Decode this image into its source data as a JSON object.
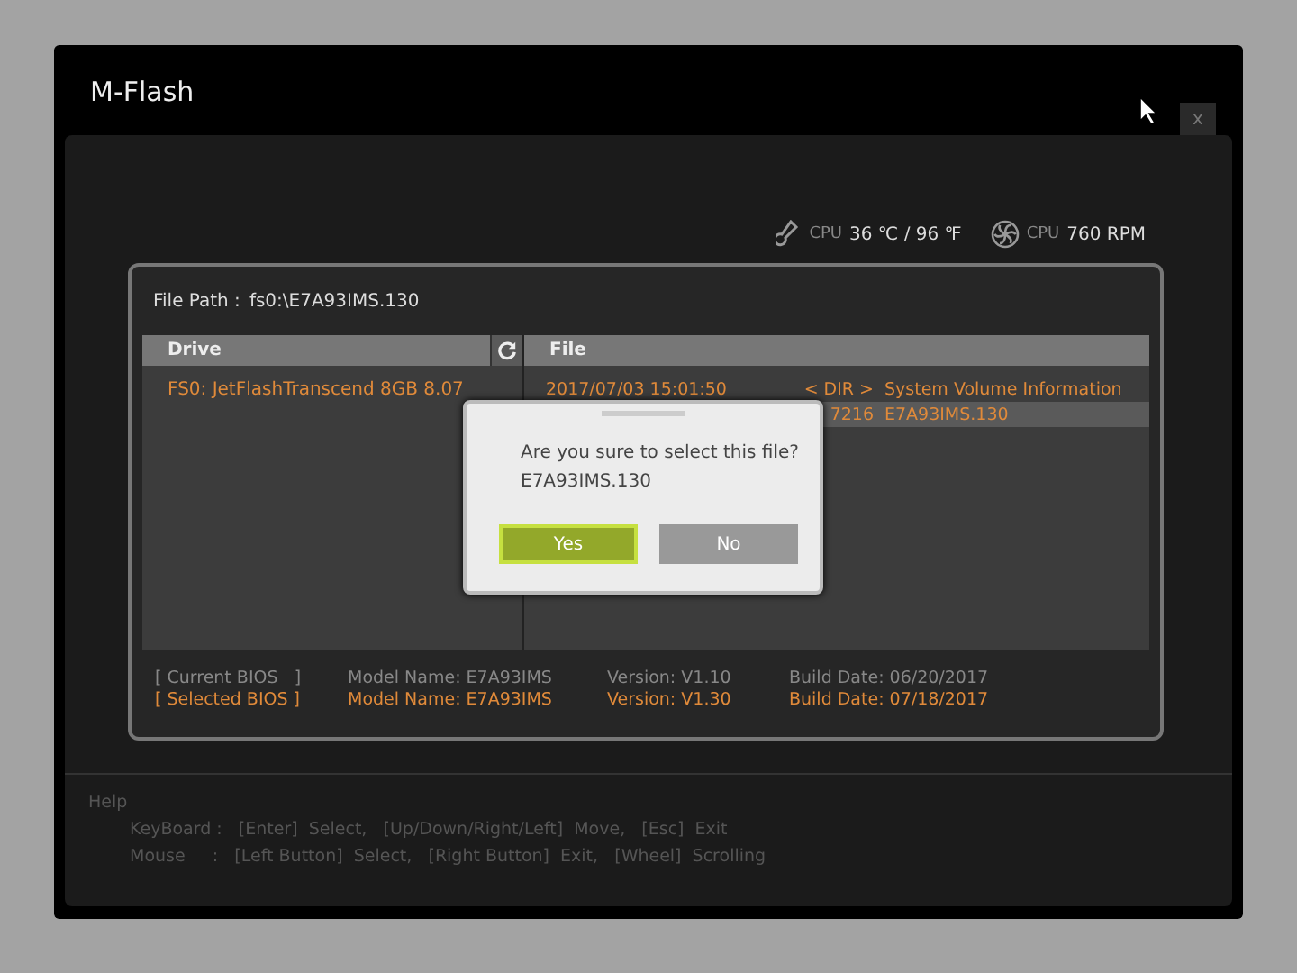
{
  "window": {
    "title": "M-Flash",
    "close": "x"
  },
  "sensors": [
    {
      "kind": "temp",
      "label": "CPU",
      "reading": "36 ℃ / 96 ℉"
    },
    {
      "kind": "fan",
      "label": "CPU",
      "reading": "760 RPM"
    }
  ],
  "file_path": {
    "label": "File Path :",
    "value": "fs0:\\E7A93IMS.130"
  },
  "drives": {
    "header": "Drive",
    "items": [
      {
        "name": "FS0: JetFlashTranscend 8GB 8.07",
        "selected": false
      }
    ]
  },
  "files": {
    "header": "File",
    "rows": [
      {
        "date": "2017/07/03 15:01:50",
        "size": "< DIR >",
        "name": "System Volume Information",
        "selected": false
      },
      {
        "size": "7216",
        "name": "E7A93IMS.130",
        "selected": true
      }
    ]
  },
  "bios": [
    {
      "label": "[ Current BIOS   ]",
      "model": "Model Name: E7A93IMS",
      "version": "Version: V1.10",
      "date": "Build Date: 06/20/2017",
      "selected": false
    },
    {
      "label": "[ Selected BIOS ]",
      "model": "Model Name: E7A93IMS",
      "version": "Version: V1.30",
      "date": "Build Date: 07/18/2017",
      "selected": true
    }
  ],
  "dialog": {
    "message": "Are you sure to select this file?",
    "file": "E7A93IMS.130",
    "buttons": [
      {
        "label": "Yes",
        "selected": true
      },
      {
        "label": "No",
        "selected": false
      }
    ]
  },
  "help": {
    "title": "Help",
    "lines": [
      "KeyBoard :   [Enter]  Select,   [Up/Down/Right/Left]  Move,   [Esc]  Exit",
      "Mouse     :   [Left Button]  Select,   [Right Button]  Exit,   [Wheel]  Scrolling"
    ]
  }
}
